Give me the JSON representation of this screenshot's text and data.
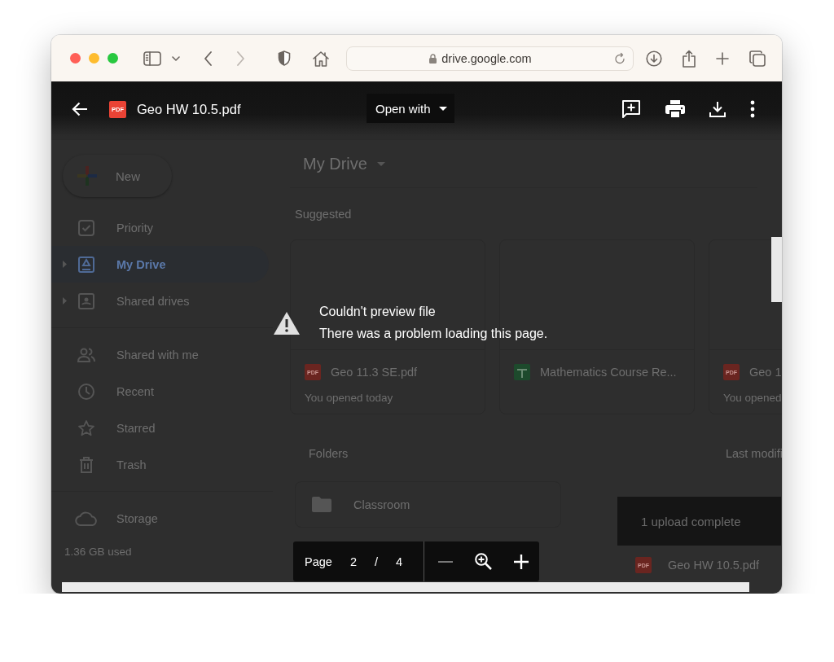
{
  "browser": {
    "url": "drive.google.com",
    "navigation": [
      {
        "kind": "back",
        "disabled": false
      },
      {
        "kind": "forward",
        "disabled": true
      }
    ]
  },
  "drive": {
    "sidebar": {
      "new_button": "New",
      "items": [
        {
          "kind": "priority",
          "label": "Priority",
          "selected": false,
          "expandable": false
        },
        {
          "kind": "my-drive",
          "label": "My Drive",
          "selected": true,
          "expandable": true
        },
        {
          "kind": "shared-drives",
          "label": "Shared drives",
          "selected": false,
          "expandable": true
        },
        {
          "kind": "shared",
          "label": "Shared with me",
          "selected": false,
          "expandable": false
        },
        {
          "kind": "recent",
          "label": "Recent",
          "selected": false,
          "expandable": false
        },
        {
          "kind": "starred",
          "label": "Starred",
          "selected": false,
          "expandable": false
        },
        {
          "kind": "trash",
          "label": "Trash",
          "selected": false,
          "expandable": false
        }
      ],
      "storage": {
        "label": "Storage",
        "usage": "1.36 GB used"
      }
    },
    "main": {
      "title": "My Drive",
      "suggested_heading": "Suggested",
      "suggested": [
        {
          "kind": "pdf",
          "badge": "PDF",
          "name": "Geo 11.3 SE.pdf",
          "subtitle": "You opened today"
        },
        {
          "kind": "sheet",
          "name": "Mathematics Course Re..."
        },
        {
          "kind": "pdf",
          "badge": "PDF",
          "name": "Geo 1",
          "subtitle": "You opened"
        }
      ],
      "folders_heading": "Folders",
      "sort_label": "Last modifi",
      "folders": [
        {
          "name": "Classroom"
        }
      ]
    },
    "upload_toast": {
      "title": "1 upload complete",
      "files": [
        {
          "kind": "pdf",
          "badge": "PDF",
          "name": "Geo HW 10.5.pdf"
        }
      ]
    }
  },
  "viewer": {
    "file_badge": "PDF",
    "file_name": "Geo HW 10.5.pdf",
    "open_with": "Open with",
    "message_title": "Couldn't preview file",
    "message_body": "There was a problem loading this page.",
    "page_bar": {
      "label": "Page",
      "current": "2",
      "separator": "/",
      "total": "4",
      "zoom_out_disabled": true
    }
  }
}
